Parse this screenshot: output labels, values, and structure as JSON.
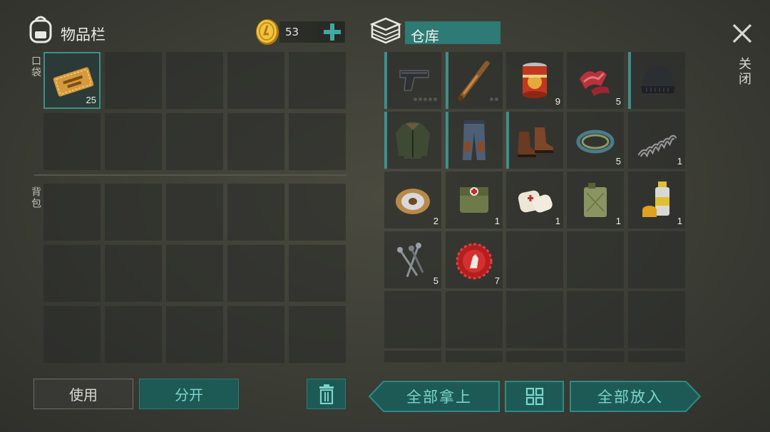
{
  "inventory": {
    "title": "物品栏",
    "pocket_label": "口袋",
    "backpack_label": "背包"
  },
  "currency": {
    "amount": "53"
  },
  "storage": {
    "title": "仓库"
  },
  "close_label": "关闭",
  "pocket_items": [
    {
      "name": "coupon",
      "count": "25"
    }
  ],
  "storage_items": [
    {
      "name": "pistol",
      "count": ""
    },
    {
      "name": "baseball-bat",
      "count": ""
    },
    {
      "name": "canned-food",
      "count": "9"
    },
    {
      "name": "raw-meat",
      "count": "5"
    },
    {
      "name": "beanie",
      "count": ""
    },
    {
      "name": "jacket",
      "count": ""
    },
    {
      "name": "pants",
      "count": ""
    },
    {
      "name": "boots",
      "count": ""
    },
    {
      "name": "rope",
      "count": "5"
    },
    {
      "name": "spring",
      "count": "1"
    },
    {
      "name": "wire-spool",
      "count": "2"
    },
    {
      "name": "medkit-bag",
      "count": "1"
    },
    {
      "name": "bandage",
      "count": "1"
    },
    {
      "name": "jerrycan",
      "count": "1"
    },
    {
      "name": "spray-paint",
      "count": "1"
    },
    {
      "name": "nails",
      "count": "5"
    },
    {
      "name": "bottle-cap",
      "count": "7"
    }
  ],
  "buttons": {
    "use": "使用",
    "split": "分开",
    "take_all": "全部拿上",
    "put_all": "全部放入"
  },
  "colors": {
    "accent": "#3e8f8a",
    "button_bg": "#1d5a56"
  }
}
